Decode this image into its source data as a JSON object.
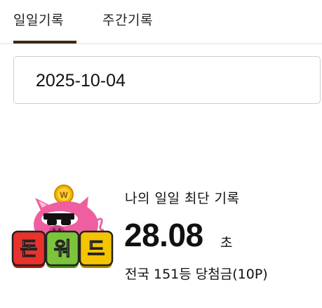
{
  "tabs": [
    {
      "label": "일일기록",
      "active": true
    },
    {
      "label": "주간기록",
      "active": false
    }
  ],
  "date_field": {
    "value": "2025-10-04"
  },
  "logo": {
    "tiles": [
      "돈",
      "워",
      "드"
    ],
    "coin_letter": "W"
  },
  "record": {
    "label": "나의 일일 최단 기록",
    "time": "28.08",
    "time_unit": "초",
    "rank_text": "전국 151등 당첨금(10P)"
  },
  "colors": {
    "tab_indicator": "#3b2a14",
    "tile_red": "#e8322b",
    "tile_green": "#7cc43a",
    "tile_yellow": "#f5c400",
    "pig_pink": "#ee5fa0"
  }
}
